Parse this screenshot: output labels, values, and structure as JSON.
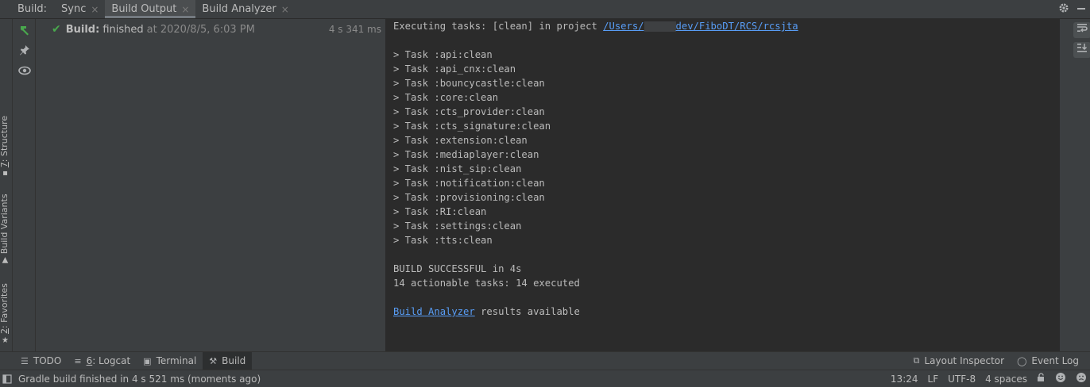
{
  "header": {
    "title": "Build:",
    "tabs": [
      {
        "label": "Sync"
      },
      {
        "label": "Build Output"
      },
      {
        "label": "Build Analyzer"
      }
    ],
    "close_glyph": "×",
    "settings_icon": "gear-icon",
    "minimize_icon": "minimize-icon"
  },
  "left_stripe": {
    "structure": {
      "num": "7",
      "label": ": Structure"
    },
    "variants": {
      "label": "Build Variants"
    },
    "favorites": {
      "num": "2",
      "label": ": Favorites"
    }
  },
  "tree": {
    "status_label": "Build:",
    "status_text": "finished",
    "when": "at 2020/8/5, 6:03 PM",
    "duration": "4 s 341 ms"
  },
  "console": {
    "exec_prefix": "Executing tasks: [clean] in project ",
    "path_part1": "/Users/",
    "path_part2": "dev/FiboDT/RCS/rcsjta",
    "tasks": [
      "> Task :api:clean",
      "> Task :api_cnx:clean",
      "> Task :bouncycastle:clean",
      "> Task :core:clean",
      "> Task :cts_provider:clean",
      "> Task :cts_signature:clean",
      "> Task :extension:clean",
      "> Task :mediaplayer:clean",
      "> Task :nist_sip:clean",
      "> Task :notification:clean",
      "> Task :provisioning:clean",
      "> Task :RI:clean",
      "> Task :settings:clean",
      "> Task :tts:clean"
    ],
    "result": "BUILD SUCCESSFUL in 4s",
    "summary": "14 actionable tasks: 14 executed",
    "analyzer_link": "Build Analyzer",
    "analyzer_rest": " results available"
  },
  "bottom_tabs": {
    "todo": "TODO",
    "logcat_num": "6",
    "logcat_label": ": Logcat",
    "terminal": "Terminal",
    "build": "Build",
    "layout_inspector": "Layout Inspector",
    "event_log": "Event Log"
  },
  "status": {
    "message": "Gradle build finished in 4 s 521 ms (moments ago)",
    "position": "13:24",
    "line_sep": "LF",
    "encoding": "UTF-8",
    "indent": "4 spaces"
  },
  "colors": {
    "success": "#49a84d",
    "link": "#589df6",
    "console_bg": "#2b2b2b",
    "panel_bg": "#3c3f41"
  }
}
